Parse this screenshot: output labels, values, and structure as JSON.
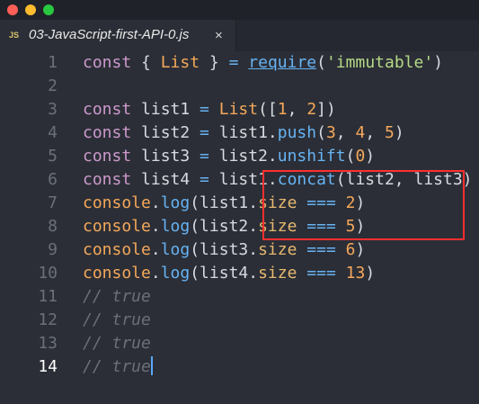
{
  "window": {
    "tab": {
      "icon": "JS",
      "title": "03-JavaScript-first-API-0.js",
      "close": "×"
    }
  },
  "editor": {
    "lines": [
      {
        "num": "1",
        "tokens": [
          "const",
          " { ",
          "List",
          " } ",
          "=",
          " ",
          "require",
          "(",
          "'immutable'",
          ")"
        ]
      },
      {
        "num": "2",
        "tokens": []
      },
      {
        "num": "3",
        "tokens": [
          "const",
          " list1 ",
          "=",
          " ",
          "List",
          "([",
          "1",
          ", ",
          "2",
          "])"
        ]
      },
      {
        "num": "4",
        "tokens": [
          "const",
          " list2 ",
          "=",
          " list1.",
          "push",
          "(",
          "3",
          ", ",
          "4",
          ", ",
          "5",
          ")"
        ]
      },
      {
        "num": "5",
        "tokens": [
          "const",
          " list3 ",
          "=",
          " list2.",
          "unshift",
          "(",
          "0",
          ")"
        ]
      },
      {
        "num": "6",
        "tokens": [
          "const",
          " list4 ",
          "=",
          " list1.",
          "concat",
          "(list2, list3)"
        ]
      },
      {
        "num": "7",
        "tokens": [
          "console",
          ".",
          "log",
          "(list1.",
          "size",
          " ",
          "===",
          " ",
          "2",
          ")"
        ]
      },
      {
        "num": "8",
        "tokens": [
          "console",
          ".",
          "log",
          "(list2.",
          "size",
          " ",
          "===",
          " ",
          "5",
          ")"
        ]
      },
      {
        "num": "9",
        "tokens": [
          "console",
          ".",
          "log",
          "(list3.",
          "size",
          " ",
          "===",
          " ",
          "6",
          ")"
        ]
      },
      {
        "num": "10",
        "tokens": [
          "console",
          ".",
          "log",
          "(list4.",
          "size",
          " ",
          "===",
          " ",
          "13",
          ")"
        ]
      },
      {
        "num": "11",
        "tokens": [
          "// true"
        ]
      },
      {
        "num": "12",
        "tokens": [
          "// true"
        ]
      },
      {
        "num": "13",
        "tokens": [
          "// true"
        ]
      },
      {
        "num": "14",
        "tokens": [
          "// true"
        ]
      }
    ],
    "active_line": "14"
  },
  "colors": {
    "background": "#2b2e36",
    "keyword": "#cc99cd",
    "class": "#f5a85a",
    "function": "#67b3f3",
    "string": "#b5d987",
    "comment": "#6b7078",
    "highlight_box": "#ff2f2f"
  }
}
